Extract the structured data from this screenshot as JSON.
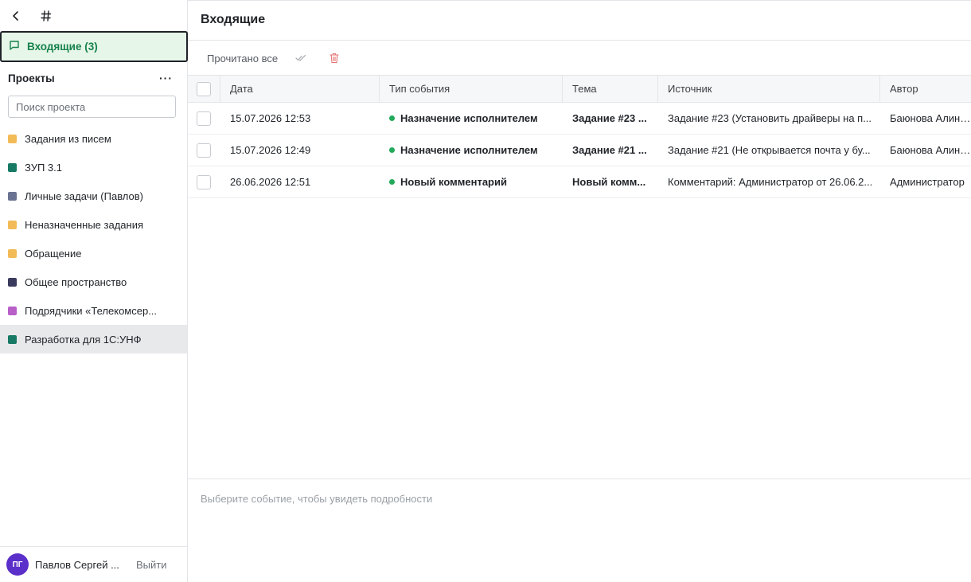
{
  "sidebar": {
    "inbox_label": "Входящие (3)",
    "projects_title": "Проекты",
    "more_label": "···",
    "search_placeholder": "Поиск проекта",
    "projects": [
      {
        "label": "Задания из писем",
        "color": "#f2bb58"
      },
      {
        "label": "ЗУП 3.1",
        "color": "#167a64"
      },
      {
        "label": "Личные задачи (Павлов)",
        "color": "#6a7391"
      },
      {
        "label": "Неназначенные задания",
        "color": "#f2bb58"
      },
      {
        "label": "Обращение",
        "color": "#f2bb58"
      },
      {
        "label": "Общее пространство",
        "color": "#393a5c"
      },
      {
        "label": "Подрядчики «Телекомсер...",
        "color": "#b85fc8"
      },
      {
        "label": "Разработка для 1С:УНФ",
        "color": "#167a64"
      }
    ],
    "user": {
      "initials": "ПГ",
      "name": "Павлов Сергей ...",
      "logout_label": "Выйти"
    }
  },
  "main": {
    "title": "Входящие",
    "toolbar": {
      "read_all_label": "Прочитано все"
    },
    "columns": [
      "Дата",
      "Тип события",
      "Тема",
      "Источник",
      "Автор"
    ],
    "rows": [
      {
        "date": "15.07.2026 12:53",
        "type": "Назначение исполнителем",
        "subject": "Задание #23 ...",
        "source": "Задание #23 (Установить драйверы на п...",
        "author": "Баюнова Алина Серг..."
      },
      {
        "date": "15.07.2026 12:49",
        "type": "Назначение исполнителем",
        "subject": "Задание #21 ...",
        "source": "Задание #21 (Не открывается почта у бу...",
        "author": "Баюнова Алина Серг..."
      },
      {
        "date": "26.06.2026 12:51",
        "type": "Новый комментарий",
        "subject": "Новый комм...",
        "source": "Комментарий: Администратор от 26.06.2...",
        "author": "Администратор"
      }
    ],
    "detail_hint": "Выберите событие, чтобы увидеть подробности"
  },
  "colors": {
    "accent_green": "#17824d",
    "inbox_bg": "#e6f6e8",
    "status_dot": "#22a95b",
    "avatar": "#5b2fc9"
  }
}
